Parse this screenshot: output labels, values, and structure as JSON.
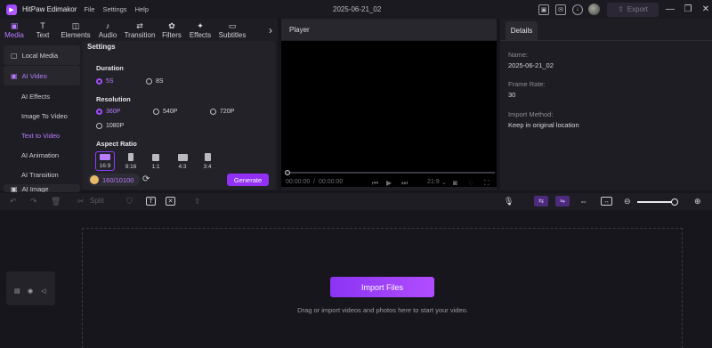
{
  "titlebar": {
    "app_name": "HitPaw Edimakor",
    "menu": [
      "File",
      "Settings",
      "Help"
    ],
    "project_title": "2025-06-21_02",
    "export_label": "Export"
  },
  "tabs": [
    {
      "label": "Media",
      "icon": "media-icon"
    },
    {
      "label": "Text",
      "icon": "text-icon"
    },
    {
      "label": "Elements",
      "icon": "elements-icon"
    },
    {
      "label": "Audio",
      "icon": "audio-icon"
    },
    {
      "label": "Transition",
      "icon": "transition-icon"
    },
    {
      "label": "Filters",
      "icon": "filters-icon"
    },
    {
      "label": "Effects",
      "icon": "effects-icon"
    },
    {
      "label": "Subtitles",
      "icon": "subtitles-icon"
    }
  ],
  "sidenav": {
    "local_media": "Local Media",
    "ai_video": "AI Video",
    "items": [
      "AI Effects",
      "Image To Video",
      "Text to Video",
      "AI Animation",
      "AI Transition"
    ],
    "ai_image": "AI Image"
  },
  "settings": {
    "title": "Settings",
    "duration_label": "Duration",
    "durations": [
      "5S",
      "8S"
    ],
    "resolution_label": "Resolution",
    "resolutions": [
      "360P",
      "540P",
      "720P",
      "1080P"
    ],
    "aspect_label": "Aspect Ratio",
    "ratios": [
      "16:9",
      "9:16",
      "1:1",
      "4:3",
      "3:4"
    ],
    "credits": "160/10100",
    "generate_label": "Generate"
  },
  "player": {
    "title": "Player",
    "time_current": "00:00:00",
    "time_separator": "/",
    "time_total": "00:00:00",
    "aspect": "21:9"
  },
  "details": {
    "tab": "Details",
    "name_label": "Name:",
    "name_value": "2025-06-21_02",
    "frame_rate_label": "Frame Rate:",
    "frame_rate_value": "30",
    "import_method_label": "Import Method:",
    "import_method_value": "Keep in original location"
  },
  "toolbar": {
    "split_label": "Split"
  },
  "timeline": {
    "import_label": "Import Files",
    "hint": "Drag or import videos and photos here to start your video."
  }
}
